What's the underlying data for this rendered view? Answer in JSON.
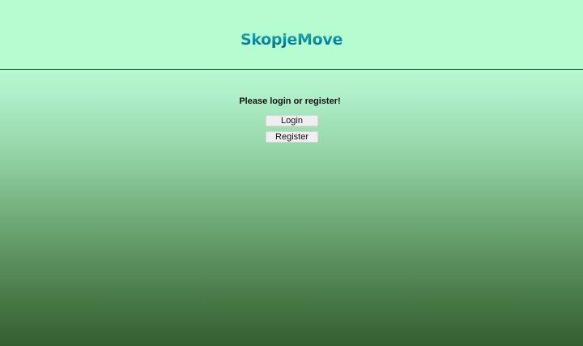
{
  "header": {
    "title": "SkopjeMove"
  },
  "main": {
    "prompt": "Please login or register!",
    "login_label": "Login",
    "register_label": "Register"
  }
}
